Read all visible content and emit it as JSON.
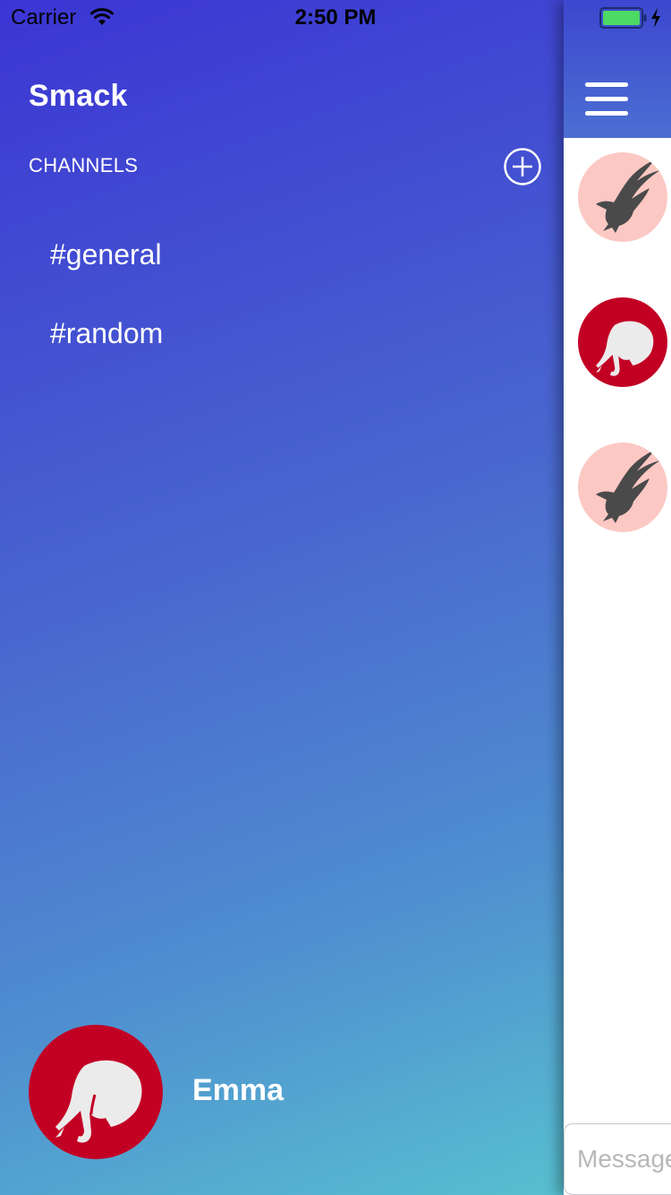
{
  "status_bar": {
    "carrier": "Carrier",
    "time": "2:50 PM",
    "wifi_icon": "wifi-icon",
    "battery_icon": "battery-full-icon",
    "charging_icon": "bolt-icon"
  },
  "side_menu": {
    "app_title": "Smack",
    "channels_header": "CHANNELS",
    "add_channel_icon": "plus-circle-icon",
    "channels": [
      {
        "label": "#general"
      },
      {
        "label": "#random"
      }
    ],
    "user": {
      "name": "Emma",
      "avatar_icon": "elephant-icon",
      "avatar_color": "#c20024"
    }
  },
  "chat_panel": {
    "menu_icon": "hamburger-menu-icon",
    "header_color": "#4560d0",
    "message_avatars": [
      {
        "icon": "eagle-icon",
        "color": "#fcc8c3"
      },
      {
        "icon": "elephant-icon",
        "color": "#c20024"
      },
      {
        "icon": "eagle-icon",
        "color": "#fcc8c3"
      }
    ],
    "message_input": {
      "placeholder": "Message",
      "value": ""
    }
  },
  "colors": {
    "gradient_start": "#3b35d4",
    "gradient_end": "#58bfd0",
    "text": "#ffffff"
  }
}
